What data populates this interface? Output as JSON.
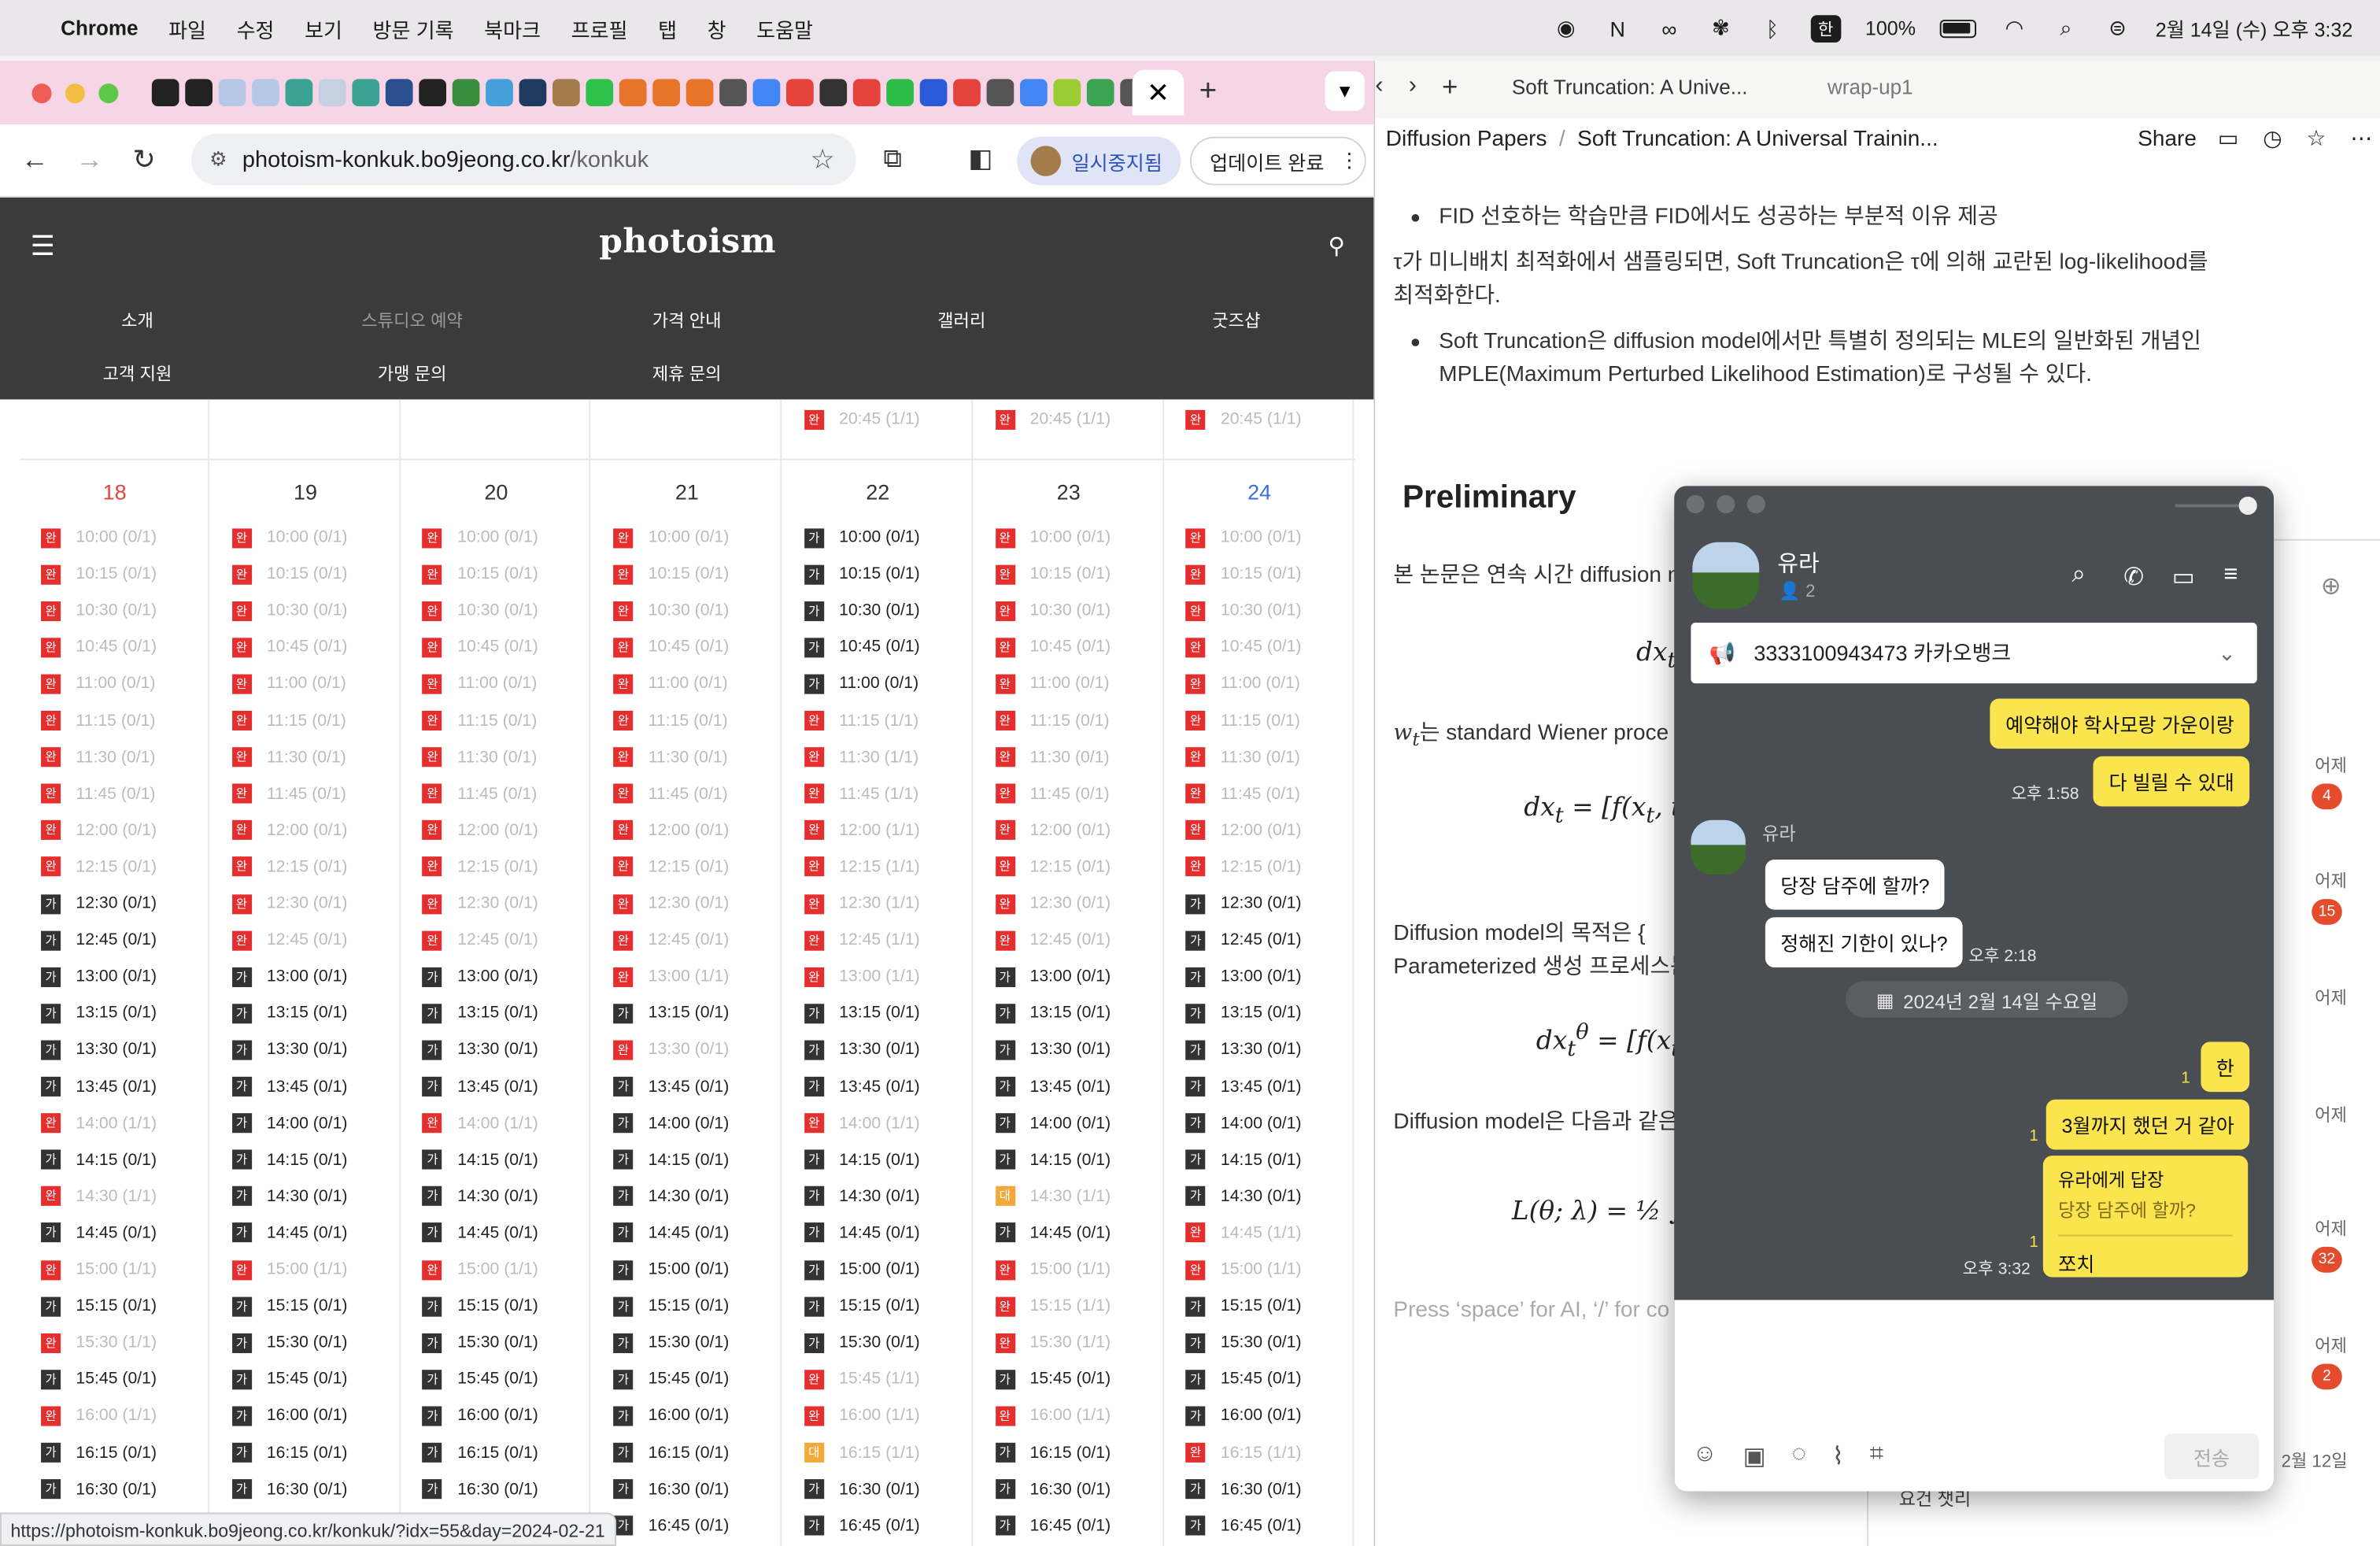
{
  "menubar": {
    "app": "Chrome",
    "items": [
      "파일",
      "수정",
      "보기",
      "방문 기록",
      "북마크",
      "프로필",
      "탭",
      "창",
      "도움말"
    ],
    "ime": "한",
    "battery": "100%",
    "datetime": "2월 14일 (수) 오후 3:32"
  },
  "browser": {
    "url_host": "photoism-konkuk.bo9jeong.co.kr",
    "url_path": "/konkuk",
    "profile_status": "일시중지됨",
    "update_label": "업데이트 완료",
    "status_url": "https://photoism-konkuk.bo9jeong.co.kr/konkuk/?idx=55&day=2024-02-21"
  },
  "site": {
    "logo": "photoism",
    "nav_row1": [
      "소개",
      "스튜디오 예약",
      "가격 안내",
      "갤러리",
      "굿즈샵"
    ],
    "nav_row2": [
      "고객 지원",
      "가맹 문의",
      "제휴 문의"
    ],
    "top_slot": "20:45 (1/1)",
    "days": [
      "18",
      "19",
      "20",
      "21",
      "22",
      "23",
      "24"
    ],
    "times": [
      "10:00",
      "10:15",
      "10:30",
      "10:45",
      "11:00",
      "11:15",
      "11:30",
      "11:45",
      "12:00",
      "12:15",
      "12:30",
      "12:45",
      "13:00",
      "13:15",
      "13:30",
      "13:45",
      "14:00",
      "14:15",
      "14:30",
      "14:45",
      "15:00",
      "15:15",
      "15:30",
      "15:45",
      "16:00",
      "16:15",
      "16:30",
      "16:45"
    ],
    "grid": [
      "WWWWWWWWWWGGGGGGWGWGWGWGWGGG",
      "WWWWWWWWWWWWGGGGGGGGWGGGGGGG",
      "WWWWWWWWWWWWGGGGWGGGWGGGGGGG",
      "WWWWWWWWWWWWWGWGGGGGGGGGGGGG",
      "GGGGGWWWWWWWWGGGWGGGGGGWWDGG",
      "WWWWWWWWWWWWGGGGGGDGWWWGWGGG",
      "WWWWWWWWWWGGGGGGGGGWWGGGGWGG"
    ],
    "badges": {
      "W": "완",
      "G": "가",
      "D": "대"
    }
  },
  "notion": {
    "tabs": [
      "Soft Truncation: A Unive...",
      "wrap-up1"
    ],
    "breadcrumb": [
      "Diffusion Papers",
      "/",
      "Soft Truncation: A Universal Trainin..."
    ],
    "share": "Share",
    "p0": "FID 선호하는 학습만큼 FID에서도 성공하는 부분적 이유 제공",
    "p1a": "τ가 미니배치 최적화에서 샘플링되면, Soft Truncation은 τ에 의해 교란된 log-likelihood를",
    "p1b": "최적화한다.",
    "p2a": "Soft Truncation은 diffusion model에서만 특별히 정의되는 MLE의 일반화된 개념인",
    "p2b": "MPLE(Maximum Perturbed Likelihood Estimation)로 구성될 수 있다.",
    "h2": "Preliminary",
    "p3": "본 논문은 연속 시간 diffusion m",
    "p4": "는 standard Wiener proce",
    "p5a": "Diffusion model의 목적은 {",
    "p5b": "Parameterized 생성 프로세스는",
    "p6": "Diffusion model은 다음과 같은",
    "placeholder": "Press ‘space’ for AI, ‘/’ for co"
  },
  "kakao": {
    "name": "유라",
    "members": "2",
    "notice": "3333100943473 카카오뱅크",
    "msgs": {
      "m1": "예약해야 학사모랑 가운이랑",
      "m2": "다 빌릴 수 있대",
      "t1": "오후 1:58",
      "sender": "유라",
      "m3": "당장 담주에 할까?",
      "m4": "정해진 기한이 있나?",
      "t2": "오후 2:18",
      "date": "2024년 2월 14일 수요일",
      "m5": "한",
      "m6": "3월까지 했던 거 같아",
      "reply_to": "유라에게 답장",
      "reply_quote": "당장 담주에 할까?",
      "m7": "쪼치",
      "t3": "오후 3:32",
      "read": "1"
    },
    "send": "전송",
    "side": {
      "items": [
        {
          "time": "어제",
          "count": "4"
        },
        {
          "time": "어제",
          "count": "15"
        },
        {
          "time": "어제",
          "count": ""
        },
        {
          "time": "어제",
          "count": ""
        },
        {
          "time": "어제",
          "count": "32"
        },
        {
          "time": "어제",
          "count": "2"
        },
        {
          "time": "2월 12일",
          "count": ""
        }
      ],
      "last_name": "요건 챗리"
    }
  }
}
